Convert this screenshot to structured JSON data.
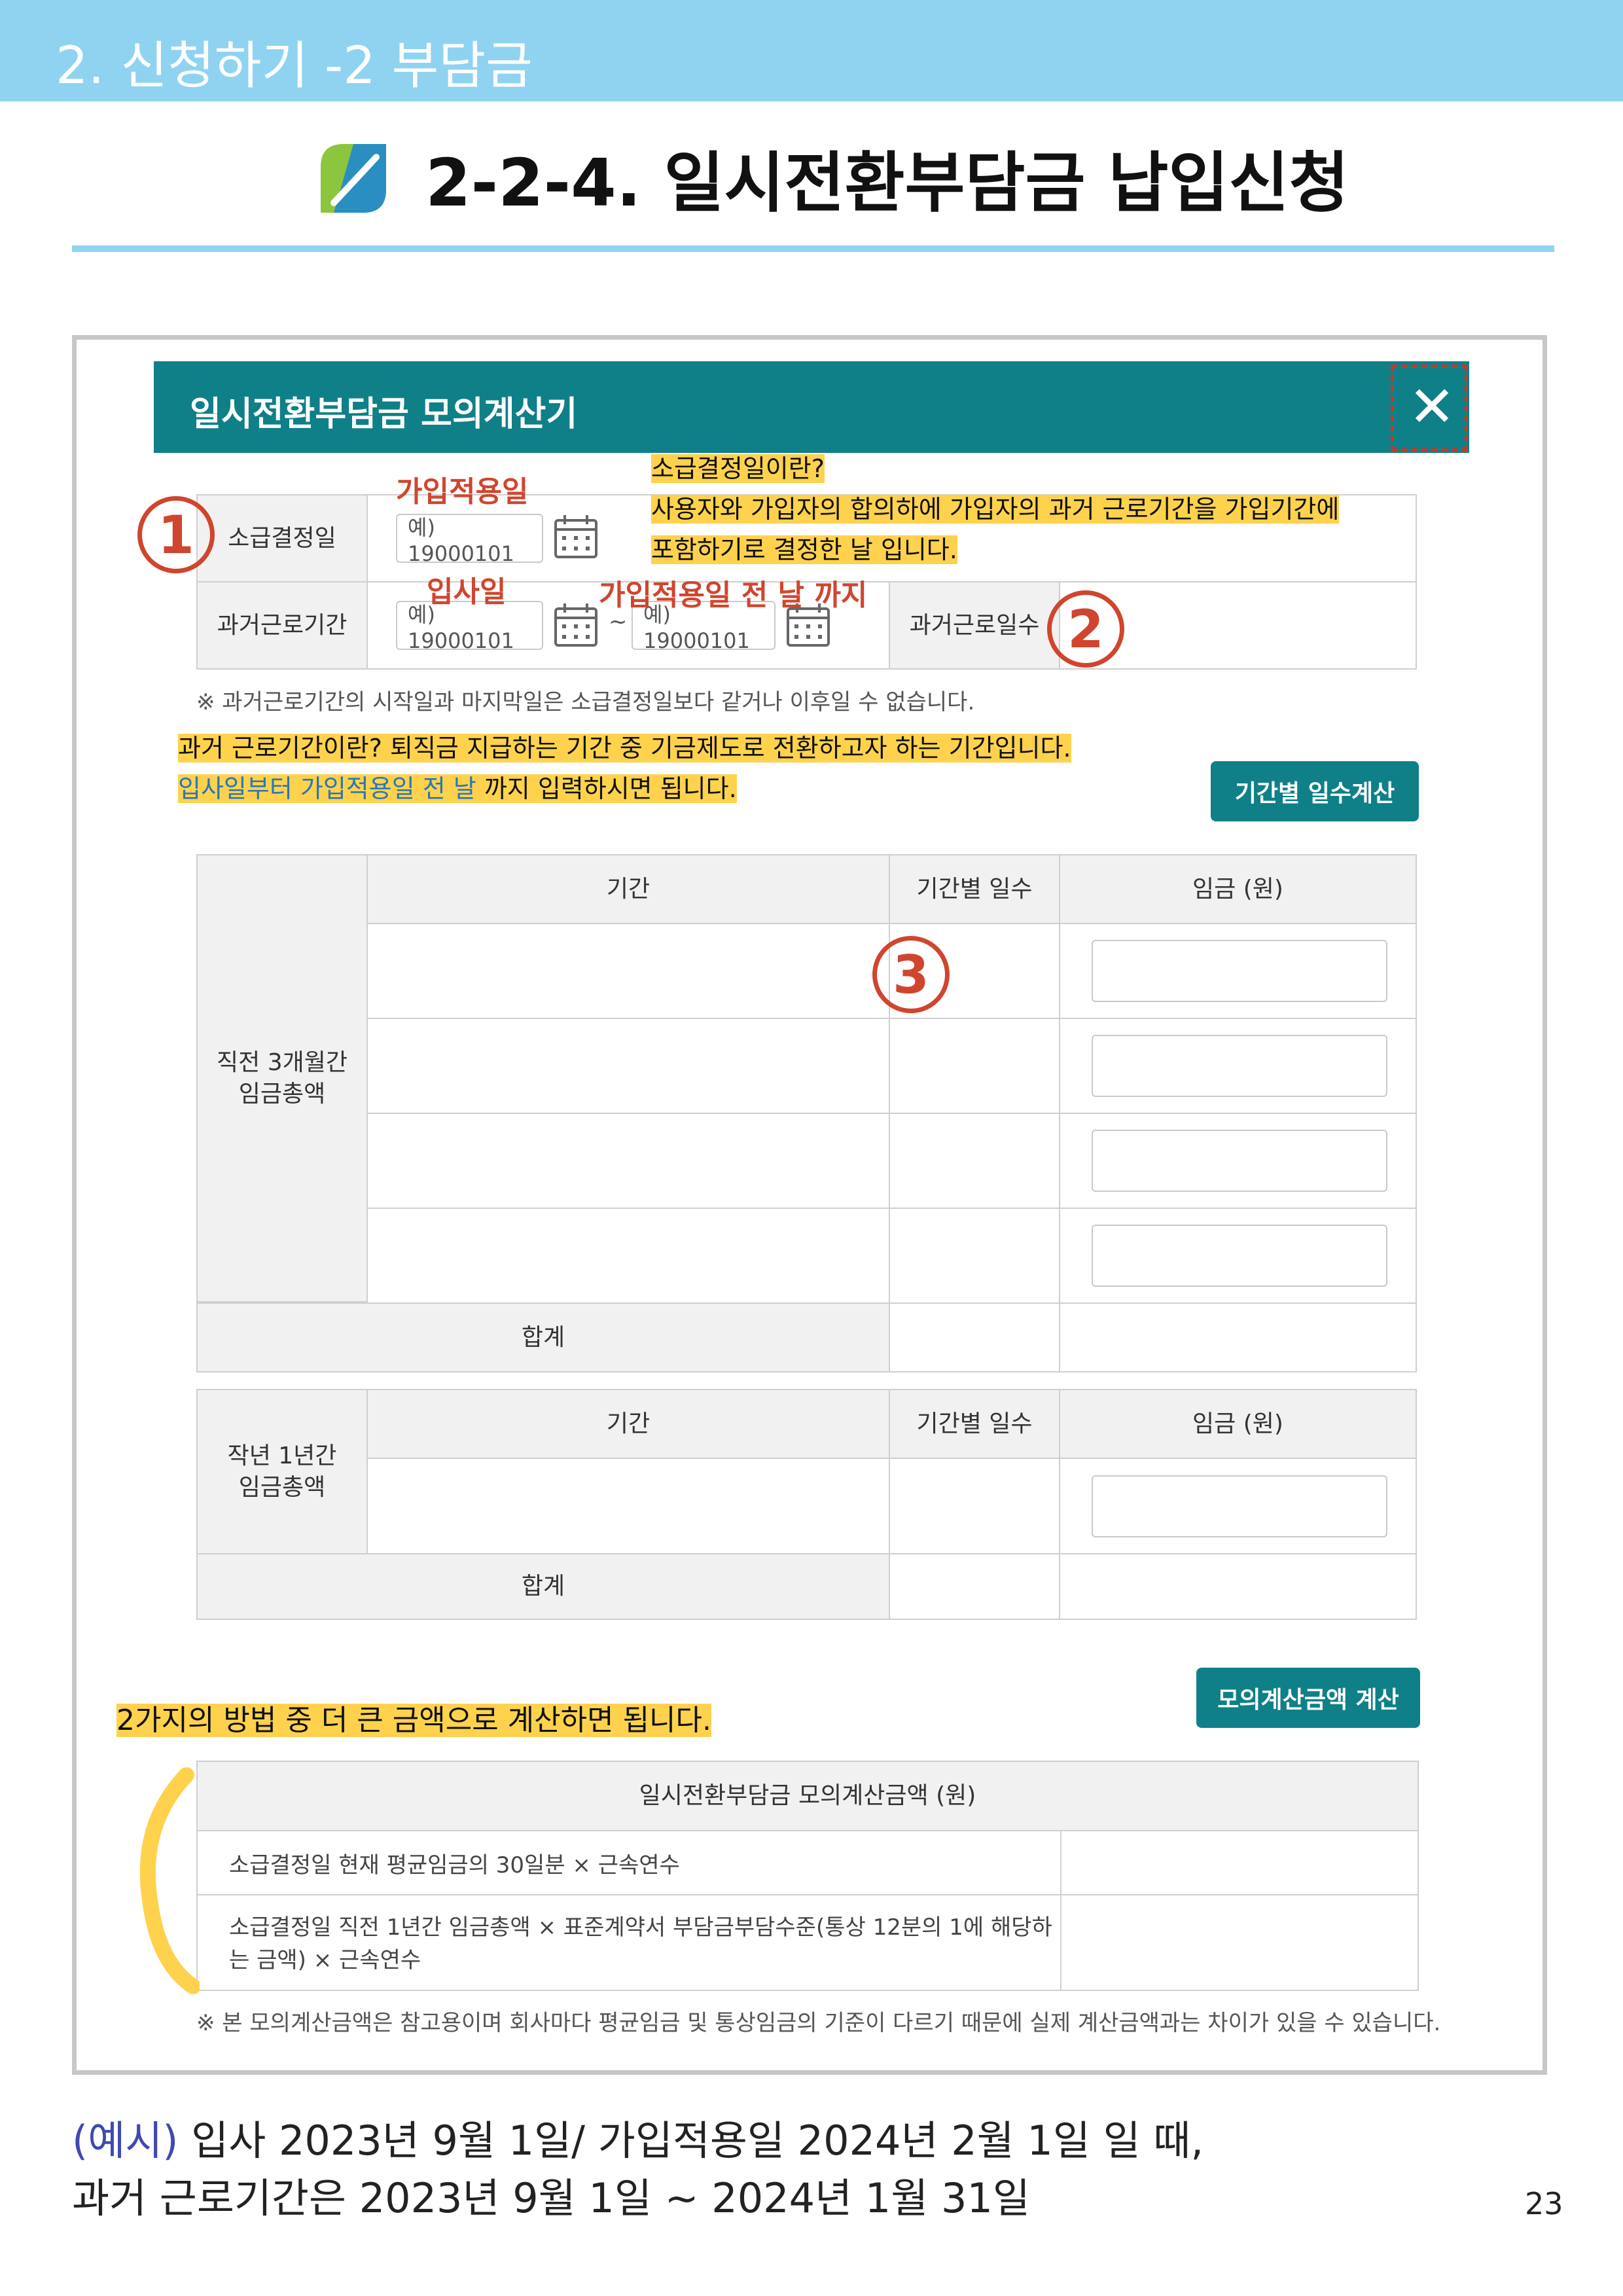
{
  "header": {
    "section": "2. 신청하기 -2 부담금"
  },
  "title": {
    "text": "2-2-4. 일시전환부담금 납입신청",
    "logo_icon": "leaf-logo-icon"
  },
  "modal": {
    "title": "일시전환부담금 모의계산기",
    "close_glyph": "✕",
    "row1_label": "소급결정일",
    "row2_label": "과거근로기간",
    "date_placeholder": "예) 19000101",
    "tilde": "~",
    "days_label": "과거근로일수",
    "footnote": "※ 과거근로기간의 시작일과 마지막일은 소급결정일보다 같거나 이후일 수 없습니다.",
    "days_button": "기간별 일수계산",
    "table1": {
      "row_header": "직전 3개월간\n임금총액",
      "col_period": "기간",
      "col_days": "기간별 일수",
      "col_wage": "임금 (원)",
      "total": "합계"
    },
    "table2": {
      "row_header": "작년 1년간\n임금총액",
      "col_period": "기간",
      "col_days": "기간별 일수",
      "col_wage": "임금 (원)",
      "total": "합계"
    },
    "calc_button": "모의계산금액 계산",
    "result": {
      "header": "일시전환부담금 모의계산금액 (원)",
      "row1": "소급결정일 현재 평균임금의 30일분 × 근속연수",
      "row2_line1": "소급결정일 직전 1년간 임금총액 × 표준계약서 부담금부담수준(통상 12분의 1에 해당하",
      "row2_line2": "는 금액) × 근속연수"
    },
    "disclaimer": "※ 본 모의계산금액은 참고용이며 회사마다 평균임금 및 통상임금의 기준이 다르기 때문에 실제 계산금액과는 차이가 있을 수 있습니다."
  },
  "annotations": {
    "join_date": "가입적용일",
    "hire_date": "입사일",
    "until_prev_day": "가입적용일 전 날 까지",
    "retro_q": "소급결정일이란?",
    "retro_a1": "사용자와 가입자의 합의하에 가입자의 과거 근로기간을 가입기간에",
    "retro_a2": "포함하기로 결정한 날 입니다.",
    "past_q": "과거 근로기간이란? 퇴직금 지급하는 기간 중 기금제도로 전환하고자 하는 기간입니다.",
    "past_a_blue": "입사일부터 가입적용일 전 날",
    "past_a_rest": " 까지 입력하시면 됩니다.",
    "two_methods": "2가지의 방법 중 더 큰 금액으로 계산하면 됩니다.",
    "num1": "1",
    "num2": "2",
    "num3": "3"
  },
  "example": {
    "prefix": "(예시)",
    "line1": " 입사 2023년 9월 1일/ 가입적용일 2024년 2월 1일 일 때,",
    "line2": "과거 근로기간은 2023년 9월 1일 ~ 2024년 1월 31일"
  },
  "page_number": "23",
  "colors": {
    "teal": "#0f8088",
    "sky": "#8fd3f0",
    "highlight": "#ffd24d",
    "annotation_red": "#d0452e"
  }
}
